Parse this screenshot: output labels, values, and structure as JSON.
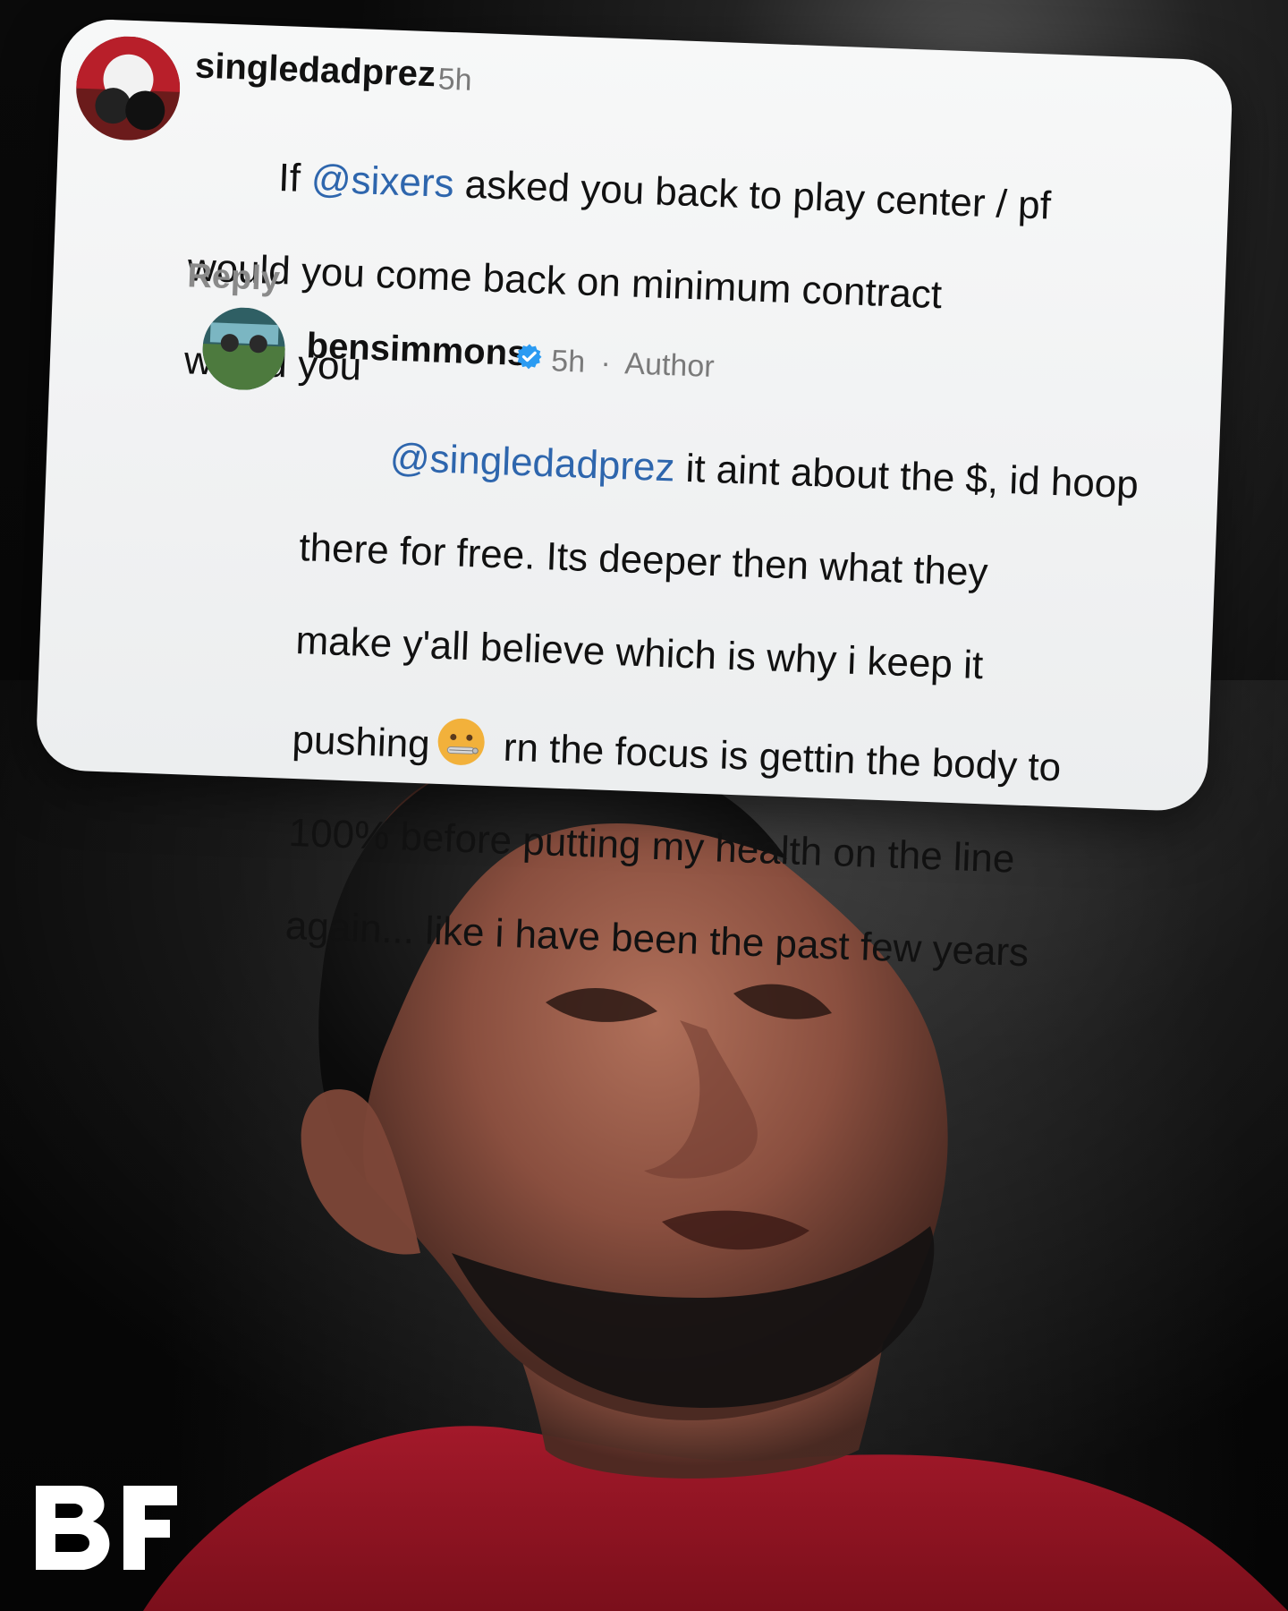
{
  "comment": {
    "username": "singledadprez",
    "time": "5h",
    "text_prefix": "If ",
    "mention": "@sixers",
    "text_line1_suffix": " asked you back to play center / pf",
    "text_line2": "would you come back on minimum contract",
    "text_line3": "would you",
    "reply_label": "Reply"
  },
  "reply": {
    "username": "bensimmons",
    "time": "5h",
    "meta_sep": "·",
    "role": "Author",
    "mention": "@singledadprez",
    "line1_suffix": " it aint about the $, id hoop",
    "line2": "there for free. Its deeper then what they",
    "line3": "make y'all believe which is why i keep it",
    "line4_prefix": "pushing",
    "line4_suffix": " rn the focus is gettin the body to",
    "line5": "100% before putting my health on the line",
    "line6": "again... like i have been the past few years",
    "emoji_icon": "zipper-mouth-face"
  },
  "brand": {
    "logo_text": "BF"
  }
}
